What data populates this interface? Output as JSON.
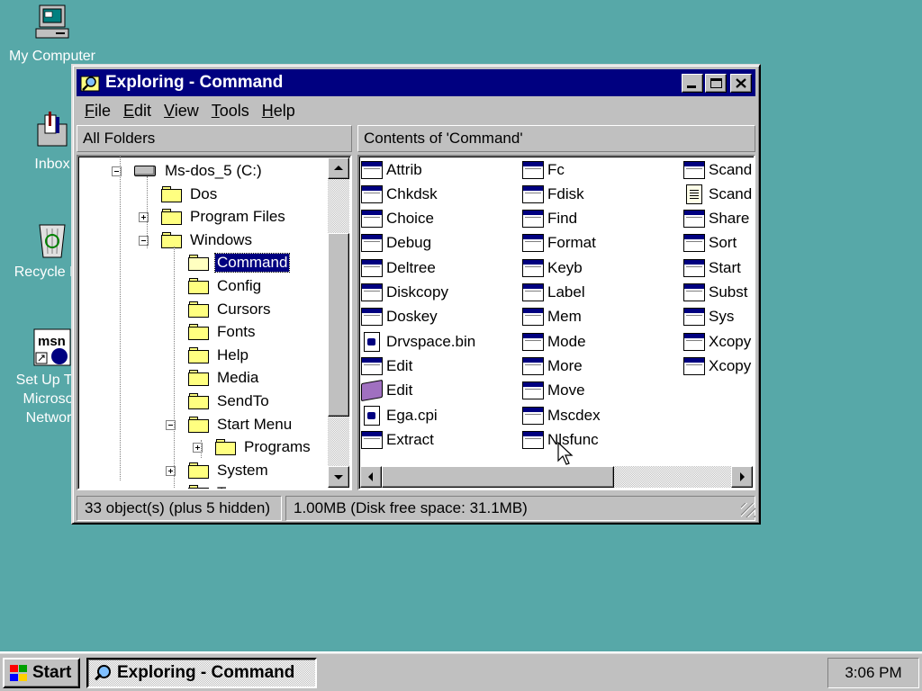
{
  "desktop": {
    "icons": [
      {
        "label": "My Computer",
        "icon": "my-computer-icon"
      },
      {
        "label": "Inbox",
        "icon": "inbox-icon"
      },
      {
        "label": "Recycle Bin",
        "icon": "recycle-bin-icon"
      },
      {
        "label": "Set Up The\nMicrosoft\nNetwork",
        "icon": "msn-icon"
      }
    ]
  },
  "window": {
    "title": "Exploring - Command",
    "menu": [
      {
        "key": "F",
        "rest": "ile"
      },
      {
        "key": "E",
        "rest": "dit"
      },
      {
        "key": "V",
        "rest": "iew"
      },
      {
        "key": "T",
        "rest": "ools"
      },
      {
        "key": "H",
        "rest": "elp"
      }
    ],
    "left_header": "All Folders",
    "right_header": "Contents of 'Command'",
    "tree": [
      {
        "label": "Ms-dos_5 (C:)",
        "type": "drive",
        "expander": "minus"
      },
      {
        "label": "Dos",
        "type": "folder",
        "expander": ""
      },
      {
        "label": "Program Files",
        "type": "folder",
        "expander": "plus"
      },
      {
        "label": "Windows",
        "type": "folder",
        "expander": "minus"
      },
      {
        "label": "Command",
        "type": "folder-open",
        "expander": "",
        "selected": true
      },
      {
        "label": "Config",
        "type": "folder",
        "expander": ""
      },
      {
        "label": "Cursors",
        "type": "folder",
        "expander": ""
      },
      {
        "label": "Fonts",
        "type": "folder",
        "expander": ""
      },
      {
        "label": "Help",
        "type": "folder",
        "expander": ""
      },
      {
        "label": "Media",
        "type": "folder",
        "expander": ""
      },
      {
        "label": "SendTo",
        "type": "folder",
        "expander": ""
      },
      {
        "label": "Start Menu",
        "type": "folder",
        "expander": "minus"
      },
      {
        "label": "Programs",
        "type": "folder-programs",
        "expander": "plus"
      },
      {
        "label": "System",
        "type": "folder",
        "expander": "plus"
      },
      {
        "label": "Temp",
        "type": "folder",
        "expander": ""
      }
    ],
    "files": [
      [
        {
          "name": "Attrib",
          "icon": "exe"
        },
        {
          "name": "Chkdsk",
          "icon": "exe"
        },
        {
          "name": "Choice",
          "icon": "exe"
        },
        {
          "name": "Debug",
          "icon": "exe"
        },
        {
          "name": "Deltree",
          "icon": "exe"
        },
        {
          "name": "Diskcopy",
          "icon": "exe"
        },
        {
          "name": "Doskey",
          "icon": "exe"
        },
        {
          "name": "Drvspace.bin",
          "icon": "doc"
        },
        {
          "name": "Edit",
          "icon": "exe"
        },
        {
          "name": "Edit",
          "icon": "book"
        },
        {
          "name": "Ega.cpi",
          "icon": "doc"
        },
        {
          "name": "Extract",
          "icon": "exe"
        }
      ],
      [
        {
          "name": "Fc",
          "icon": "exe"
        },
        {
          "name": "Fdisk",
          "icon": "exe"
        },
        {
          "name": "Find",
          "icon": "exe"
        },
        {
          "name": "Format",
          "icon": "exe"
        },
        {
          "name": "Keyb",
          "icon": "exe"
        },
        {
          "name": "Label",
          "icon": "exe"
        },
        {
          "name": "Mem",
          "icon": "exe"
        },
        {
          "name": "Mode",
          "icon": "exe"
        },
        {
          "name": "More",
          "icon": "exe"
        },
        {
          "name": "Move",
          "icon": "exe"
        },
        {
          "name": "Mscdex",
          "icon": "exe"
        },
        {
          "name": "Nlsfunc",
          "icon": "exe"
        }
      ],
      [
        {
          "name": "Scand",
          "icon": "exe"
        },
        {
          "name": "Scand",
          "icon": "txt"
        },
        {
          "name": "Share",
          "icon": "exe"
        },
        {
          "name": "Sort",
          "icon": "exe"
        },
        {
          "name": "Start",
          "icon": "exe"
        },
        {
          "name": "Subst",
          "icon": "exe"
        },
        {
          "name": "Sys",
          "icon": "exe"
        },
        {
          "name": "Xcopy",
          "icon": "exe"
        },
        {
          "name": "Xcopy",
          "icon": "exe"
        }
      ]
    ],
    "status_objects": "33 object(s) (plus 5 hidden)",
    "status_size": "1.00MB (Disk free space: 31.1MB)"
  },
  "taskbar": {
    "start_label": "Start",
    "task_label": "Exploring - Command",
    "clock": "3:06 PM"
  },
  "colors": {
    "desktop": "#57a8a8",
    "titlebar": "#000080",
    "face": "#c0c0c0"
  }
}
